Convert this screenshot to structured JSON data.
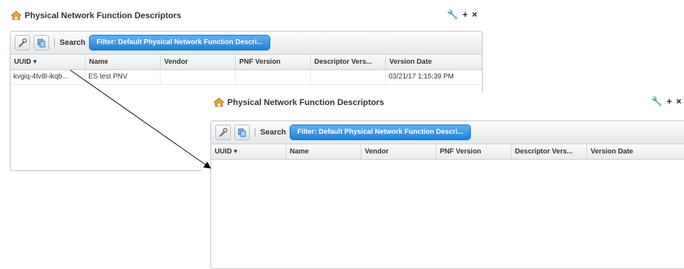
{
  "window_controls": {
    "settings": "⚲",
    "add": "+",
    "close": "×"
  },
  "panel1": {
    "title": "Physical Network Function Descriptors",
    "toolbar": {
      "search_label": "Search",
      "filter_label": "Filter: Default Physical Network Function Descri..."
    },
    "columns": [
      "UUID",
      "Name",
      "Vendor",
      "PNF Version",
      "Descriptor Vers...",
      "Version Date"
    ],
    "rows": [
      {
        "uuid": "kvgiq-4tv8l-ikqb...",
        "name": "ES test PNV",
        "vendor": "",
        "pnf_version": "",
        "descriptor_version": "",
        "version_date": "03/21/17 1:15:39 PM"
      }
    ]
  },
  "panel2": {
    "title": "Physical Network Function Descriptors",
    "toolbar": {
      "search_label": "Search",
      "filter_label": "Filter: Default Physical Network Function Descri..."
    },
    "columns": [
      "UUID",
      "Name",
      "Vendor",
      "PNF Version",
      "Descriptor Vers...",
      "Version Date"
    ]
  },
  "sort_indicator": "▾",
  "colors": {
    "filter_button": "#2a86dc",
    "arrow": "#000000"
  }
}
